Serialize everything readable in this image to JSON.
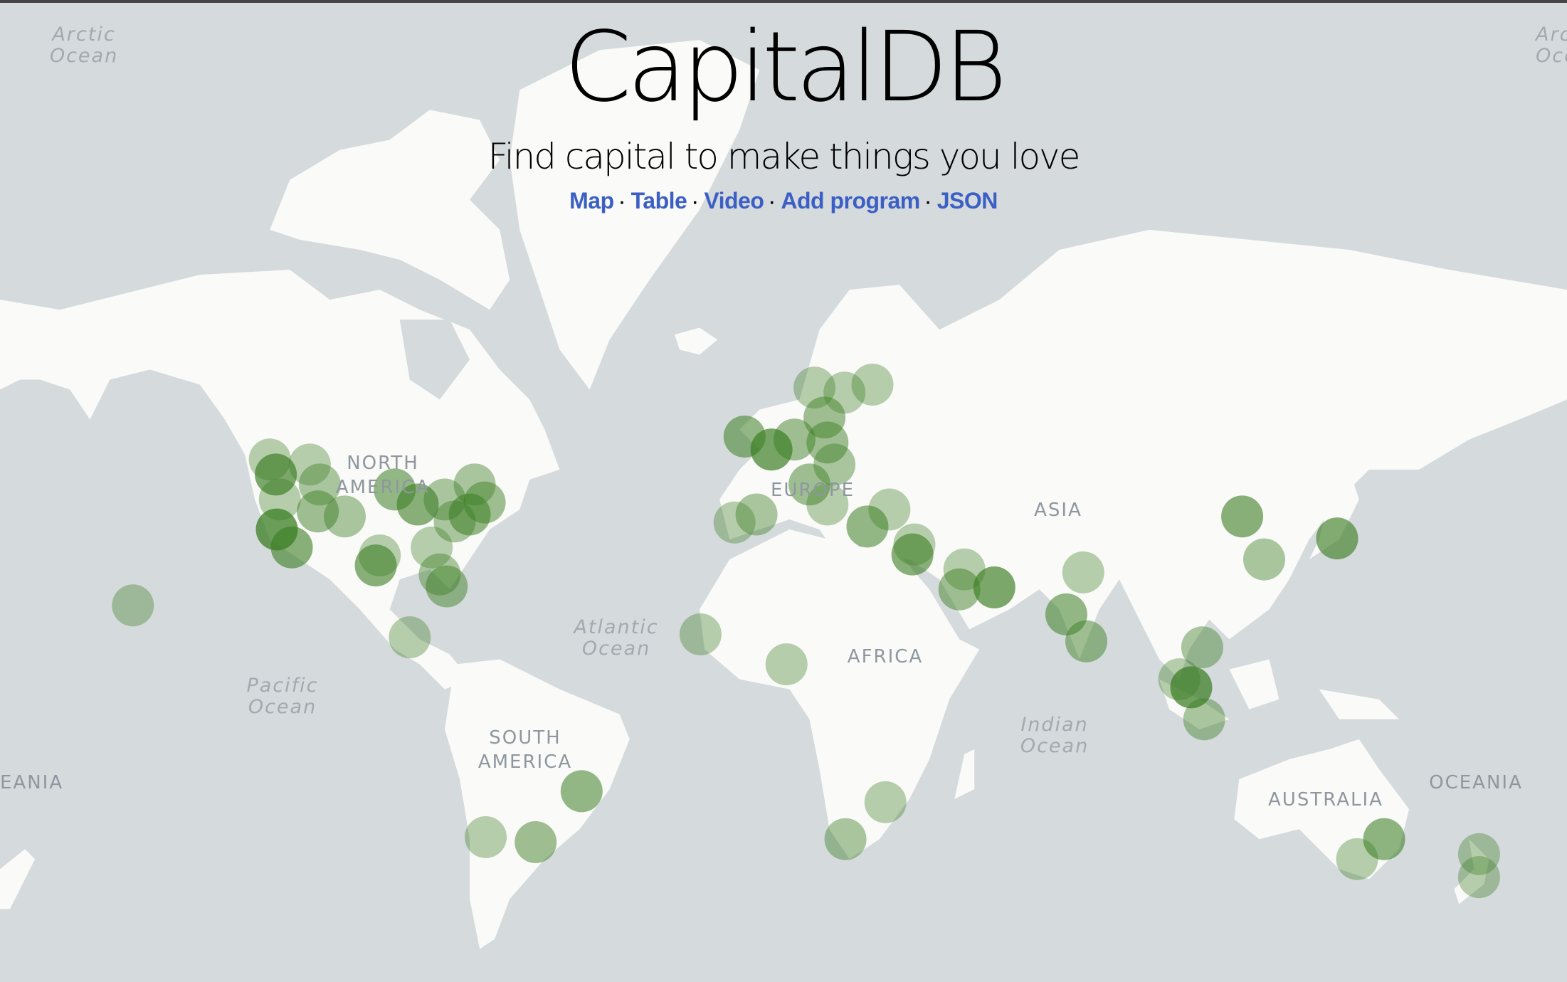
{
  "header": {
    "title": "CapitalDB",
    "tagline": "Find capital to make things you love",
    "nav": [
      {
        "label": "Map"
      },
      {
        "label": "Table"
      },
      {
        "label": "Video"
      },
      {
        "label": "Add program"
      },
      {
        "label": "JSON"
      }
    ],
    "separator": "·",
    "link_color": "#3b5fc4"
  },
  "map": {
    "ocean_color": "#d5dadd",
    "land_color": "#fafaf8",
    "marker_color": "#3a7d22",
    "continent_labels": {
      "north_america": [
        "NORTH",
        "AMERICA"
      ],
      "europe": "EUROPE",
      "asia": "ASIA",
      "africa": "AFRICA",
      "south_america": [
        "SOUTH",
        "AMERICA"
      ],
      "australia": "AUSTRALIA",
      "oceania": "OCEANIA",
      "oceania_cut": "EANIA"
    },
    "ocean_labels": {
      "arctic_left": [
        "Arctic",
        "Ocean"
      ],
      "arctic_right": [
        "Arcti",
        "Ocea"
      ],
      "pacific": [
        "Pacific",
        "Ocean"
      ],
      "atlantic": [
        "Atlantic",
        "Ocean"
      ],
      "indian": [
        "Indian",
        "Ocean"
      ]
    }
  }
}
